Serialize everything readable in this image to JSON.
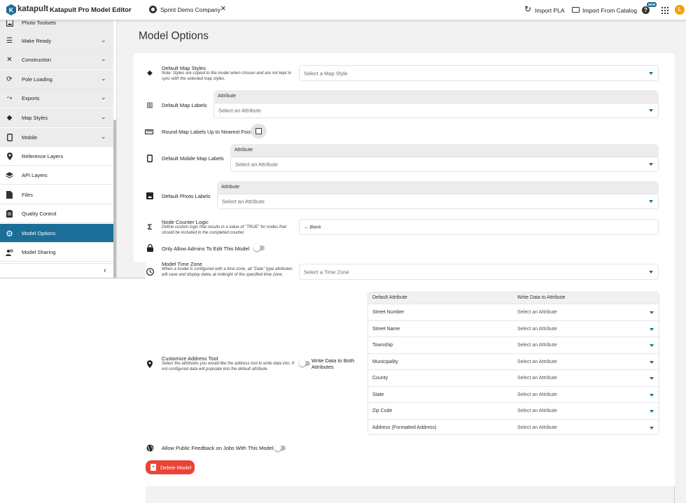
{
  "colors": {
    "brand": "#1b6e97",
    "danger": "#ea4335",
    "active_bg": "#1b6e97",
    "avatar": "#f4a100"
  },
  "header": {
    "logo_text": "katapult",
    "app_title": "Katapult Pro Model Editor",
    "company": "Sprint Demo Company",
    "import_pla": "Import PLA",
    "import_catalog": "Import From Catalog",
    "new_badge": "NEW",
    "avatar_letter": "L"
  },
  "sidebar": {
    "items": [
      {
        "label": "Photo Toolsets",
        "icon": "photo-icon",
        "expandable": false
      },
      {
        "label": "Make Ready",
        "icon": "list-icon",
        "expandable": true
      },
      {
        "label": "Construction",
        "icon": "tools-icon",
        "expandable": true
      },
      {
        "label": "Pole Loading",
        "icon": "pole-loading-icon",
        "expandable": true
      },
      {
        "label": "Exports",
        "icon": "exports-icon",
        "expandable": true
      },
      {
        "label": "Map Styles",
        "icon": "map-styles-icon",
        "expandable": true
      },
      {
        "label": "Mobile",
        "icon": "mobile-icon",
        "expandable": true
      },
      {
        "label": "Reference Layers",
        "icon": "pin-icon",
        "expandable": false
      },
      {
        "label": "API Layers",
        "icon": "layers-icon",
        "expandable": false
      },
      {
        "label": "Files",
        "icon": "file-icon",
        "expandable": false
      },
      {
        "label": "Quality Control",
        "icon": "clipboard-icon",
        "expandable": false
      },
      {
        "label": "Model Options",
        "icon": "gear-icon",
        "expandable": false,
        "active": true
      },
      {
        "label": "Model Sharing",
        "icon": "sharing-icon",
        "expandable": false
      }
    ]
  },
  "main": {
    "title": "Model Options",
    "default_map_styles": {
      "label": "Default Map Styles",
      "desc": "Note: Styles are copied to the model when chosen and are not kept in sync with the selected map styles.",
      "placeholder": "Select a Map Style"
    },
    "default_map_labels": {
      "label": "Default Map Labels",
      "header": "Attribute",
      "placeholder": "Select an Attribute"
    },
    "round_map_labels": {
      "label": "Round Map Labels Up to Nearest Foot"
    },
    "default_mobile_map_labels": {
      "label": "Default Mobile Map Labels",
      "header": "Attribute",
      "placeholder": "Select an Attribute"
    },
    "default_photo_labels": {
      "label": "Default Photo Labels",
      "header": "Attribute",
      "placeholder": "Select an Attribute"
    },
    "node_counter_logic": {
      "label": "Node Counter Logic",
      "desc": "Define custom logic that results in a value of \"TRUE\" for nodes that should be included in the completed counter.",
      "value": "Blank"
    },
    "only_admins": {
      "label": "Only Allow Admins To Edit This Model"
    },
    "model_time_zone": {
      "label": "Model Time Zone",
      "desc": "When a model is configured with a time zone, all \"Date\" type attributes will save and display dates at midnight of the specified time zone.",
      "placeholder": "Select a Time Zone"
    },
    "address_tool": {
      "label": "Customize Address Tool",
      "desc": "Select the attributes you would like the address tool to write data into. If not configured data will populate into the default attribute.",
      "toggle_label": "Write Data to Both Attributes",
      "col_default": "Default Attribute",
      "col_write": "Write Data to Attribute",
      "rows": [
        {
          "name": "Street Number",
          "value": "Select an Attribute"
        },
        {
          "name": "Street Name",
          "value": "Select an Attribute"
        },
        {
          "name": "Township",
          "value": "Select an Attribute"
        },
        {
          "name": "Municipality",
          "value": "Select an Attribute"
        },
        {
          "name": "County",
          "value": "Select an Attribute"
        },
        {
          "name": "State",
          "value": "Select an Attribute"
        },
        {
          "name": "Zip Code",
          "value": "Select an Attribute"
        },
        {
          "name": "Address (Formatted Address)",
          "value": "Select an Attribute"
        }
      ]
    },
    "public_feedback": {
      "label": "Allow Public Feedback on Jobs With This Model"
    },
    "delete_label": "Delete Model"
  }
}
